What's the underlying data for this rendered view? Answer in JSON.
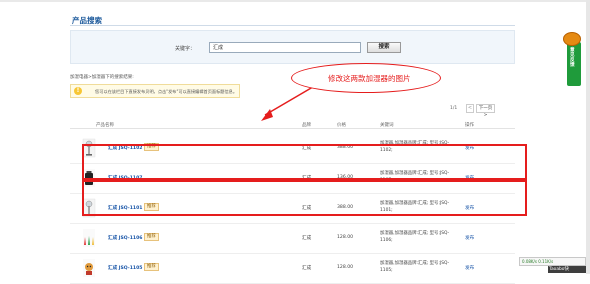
{
  "heading": "产品搜索",
  "search": {
    "label": "关键字：",
    "value": "汇成",
    "button": "搜索"
  },
  "result_desc": "加湿电器>加湿器下的搜索结果:",
  "tip": {
    "icon": "!",
    "text": "您可以在该栏目下直接发布贝明，点击\"发布\"可以直接编辑首页面标题信息。"
  },
  "pager": {
    "count": "1/1",
    "prev": "<",
    "next": "下一页>"
  },
  "table": {
    "headers": [
      "产品名称",
      "品牌",
      "价格",
      "关键词",
      "操作"
    ]
  },
  "rows": [
    {
      "name": "汇成 JSQ-1102",
      "recommend": "推荐",
      "brand": "汇成",
      "price": "388.00",
      "keywords": "加湿器,加湿器品牌:汇成; 型号:JSQ-1102;",
      "action": "发布",
      "thumb_kind": "fan-white"
    },
    {
      "name": "汇成 JSQ-1107",
      "recommend": "",
      "brand": "汇成",
      "price": "136.00",
      "keywords": "加湿器,加湿器品牌:汇成; 型号:JSQ-1107;",
      "action": "发布",
      "thumb_kind": "black-box"
    },
    {
      "name": "汇成 JSQ-1101",
      "recommend": "推荐",
      "brand": "汇成",
      "price": "388.00",
      "keywords": "加湿器,加湿器品牌:汇成; 型号:JSQ-1101;",
      "action": "发布",
      "thumb_kind": "fan-white"
    },
    {
      "name": "汇成 JSQ-1106",
      "recommend": "推荐",
      "brand": "汇成",
      "price": "128.00",
      "keywords": "加湿器,加湿器品牌:汇成; 型号:JSQ-1106;",
      "action": "发布",
      "thumb_kind": "bottles"
    },
    {
      "name": "汇成 JSQ-1105",
      "recommend": "推荐",
      "brand": "汇成",
      "price": "128.00",
      "keywords": "加湿器,加湿器品牌:汇成; 型号:JSQ-1105;",
      "action": "发布",
      "thumb_kind": "dog"
    }
  ],
  "annotation": {
    "text": "修改这两款加湿器的图片",
    "color": "#e51d1d"
  },
  "side_widget": {
    "text": "意见反馈"
  },
  "status_widget": {
    "text": "0.08K/s  0.11K/s"
  },
  "corner_tag": {
    "text": "Taoabo快"
  },
  "colors": {
    "link": "#1a56a8",
    "heading": "#1d5a9c",
    "highlight": "#e51d1d",
    "recommend_bg": "#fff1cf"
  }
}
